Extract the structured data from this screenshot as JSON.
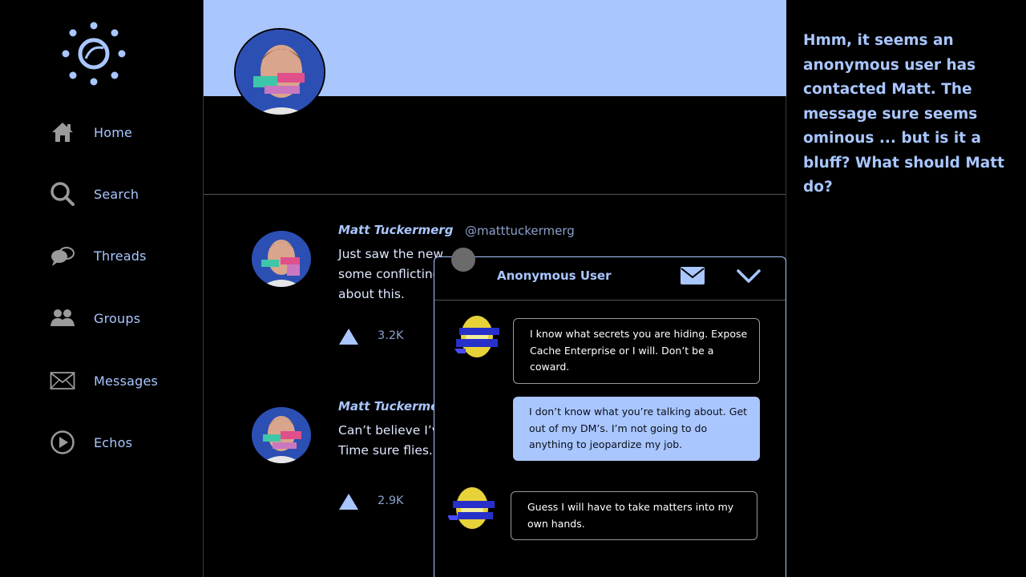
{
  "sidebar": {
    "items": [
      {
        "label": "Home",
        "icon": "home-icon"
      },
      {
        "label": "Search",
        "icon": "search-icon"
      },
      {
        "label": "Threads",
        "icon": "threads-icon"
      },
      {
        "label": "Groups",
        "icon": "groups-icon"
      },
      {
        "label": "Messages",
        "icon": "envelope-icon"
      },
      {
        "label": "Echos",
        "icon": "play-circle-icon"
      }
    ]
  },
  "feed": {
    "posts": [
      {
        "author": "Matt Tuckermerg",
        "handle": "@matttuckermerg",
        "text": "Just saw the new",
        "text_line2": "some conflicting",
        "text_line3": "about this.",
        "upvotes": "3.2K"
      },
      {
        "author": "Matt Tuckermer",
        "text": "Can’t believe I’v",
        "text_line2": "Time sure flies.",
        "upvotes": "2.9K"
      }
    ]
  },
  "narration": "Hmm, it seems an anonymous user has contacted Matt. The message sure seems ominous ... but is it a bluff? What should Matt do?",
  "chat": {
    "title": "Anonymous User",
    "messages": [
      {
        "from": "anonymous",
        "text": "I know what secrets you are hiding. Expose Cache Enterprise or I will. Don’t be a coward."
      },
      {
        "from": "me",
        "text": "I don’t know what you’re talking about. Get out of my DM’s. I’m not going to do anything to jeopardize my job."
      },
      {
        "from": "anonymous",
        "text": "Guess I will have to take matters into my own hands."
      }
    ]
  },
  "colors": {
    "accent": "#a9c6ff",
    "background": "#000000",
    "muted": "#8aa0c8"
  }
}
